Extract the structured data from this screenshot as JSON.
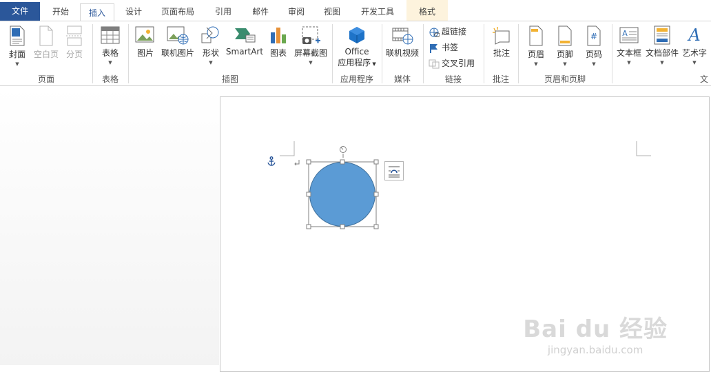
{
  "tabs": {
    "file": "文件",
    "home": "开始",
    "insert": "插入",
    "design": "设计",
    "layout": "页面布局",
    "references": "引用",
    "mailings": "邮件",
    "review": "审阅",
    "view": "视图",
    "developer": "开发工具",
    "format": "格式"
  },
  "ribbon": {
    "pages": {
      "cover": "封面",
      "blank": "空白页",
      "break": "分页",
      "label": "页面"
    },
    "tables": {
      "table": "表格",
      "label": "表格"
    },
    "illustrations": {
      "picture": "图片",
      "online_picture": "联机图片",
      "shapes": "形状",
      "smartart": "SmartArt",
      "chart": "图表",
      "screenshot": "屏幕截图",
      "label": "插图"
    },
    "apps": {
      "office_line1": "Office",
      "office_line2": "应用程序",
      "label": "应用程序"
    },
    "media": {
      "online_video": "联机视频",
      "label": "媒体"
    },
    "links": {
      "hyperlink": "超链接",
      "bookmark": "书签",
      "cross_ref": "交叉引用",
      "label": "链接"
    },
    "comments": {
      "comment": "批注",
      "label": "批注"
    },
    "header_footer": {
      "header": "页眉",
      "footer": "页脚",
      "page_number": "页码",
      "label": "页眉和页脚"
    },
    "text": {
      "textbox": "文本框",
      "quick_parts": "文档部件",
      "wordart": "艺术字",
      "label": "文"
    }
  },
  "watermark": {
    "main": "Bai du 经验",
    "sub": "jingyan.baidu.com"
  },
  "colors": {
    "file_tab": "#2b579a",
    "shape_fill": "#5b9bd5",
    "context_tab": "#fdf3dd"
  },
  "icons": [
    "cover-icon",
    "blank-page-icon",
    "page-break-icon",
    "table-icon",
    "picture-icon",
    "online-picture-icon",
    "shapes-icon",
    "smartart-icon",
    "chart-icon",
    "screenshot-icon",
    "office-apps-icon",
    "online-video-icon",
    "hyperlink-icon",
    "bookmark-icon",
    "cross-reference-icon",
    "comment-icon",
    "header-icon",
    "footer-icon",
    "page-number-icon",
    "textbox-icon",
    "quick-parts-icon",
    "wordart-icon",
    "anchor-icon",
    "rotate-handle-icon",
    "layout-options-icon"
  ]
}
